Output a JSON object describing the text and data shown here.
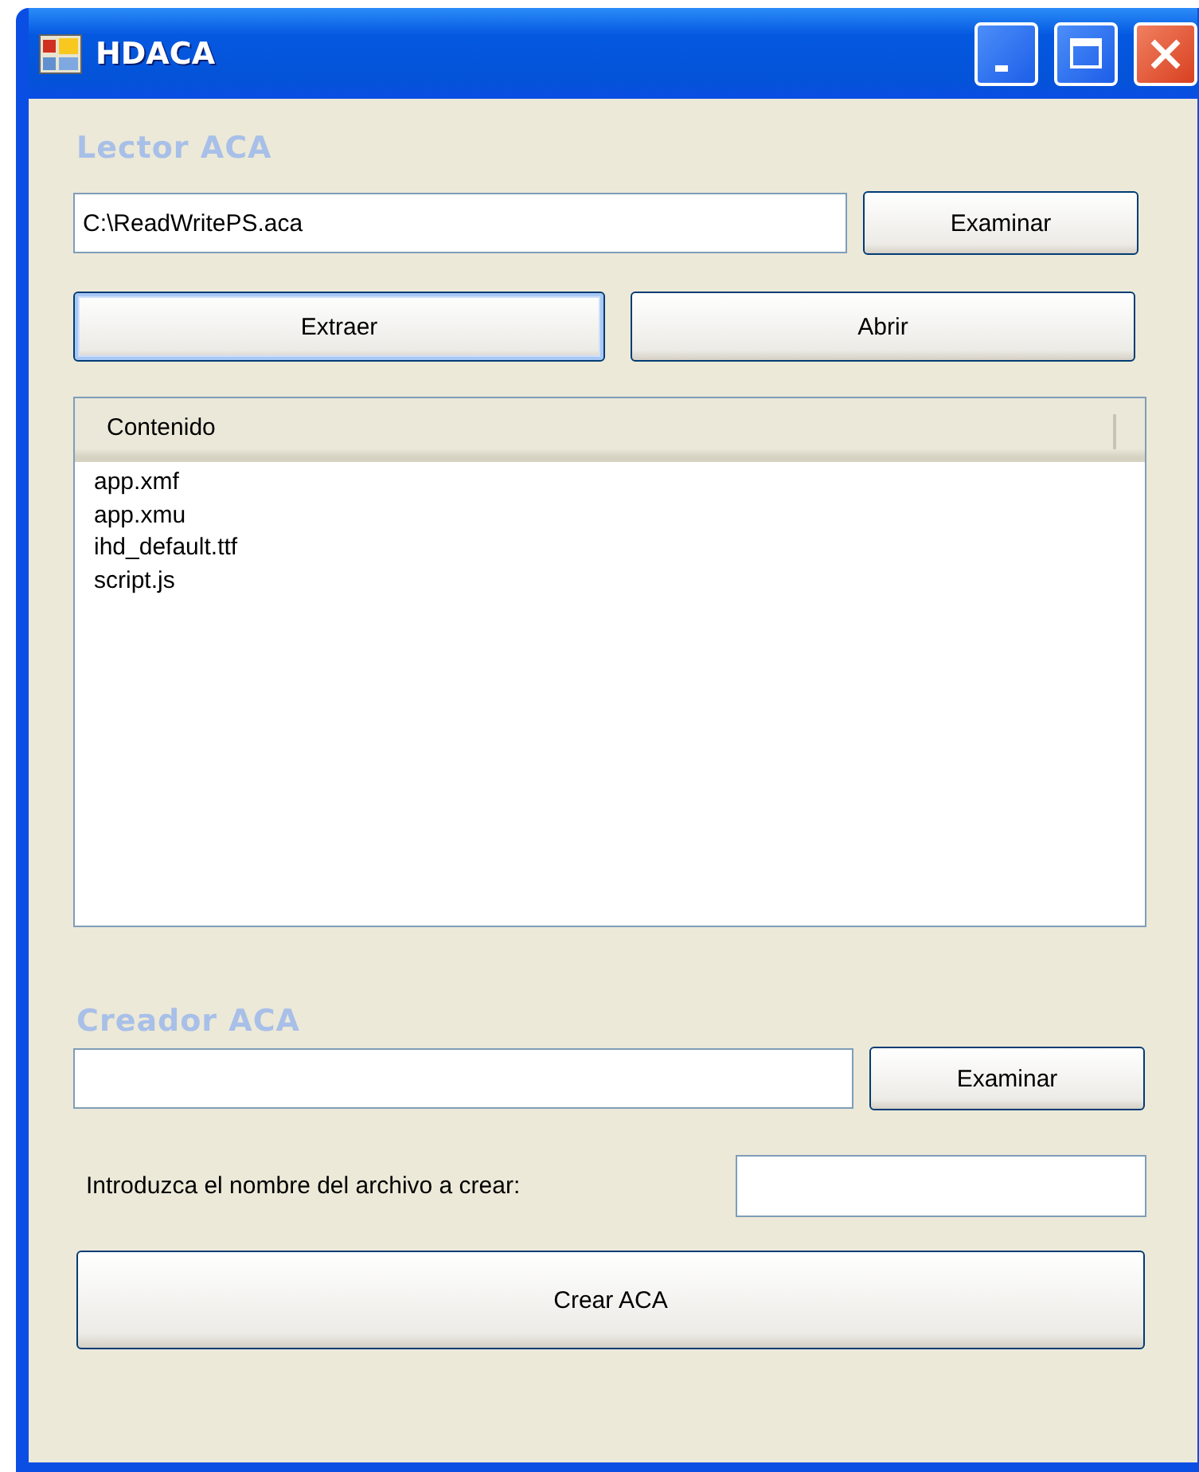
{
  "window": {
    "title": "HDACA"
  },
  "reader": {
    "heading": "Lector ACA",
    "path_field": {
      "value": "C:\\ReadWritePS.aca"
    },
    "browse_button": {
      "label": "Examinar",
      "focused": false
    },
    "buttons": [
      {
        "label": "Extraer",
        "focused": true
      },
      {
        "label": "Abrir",
        "focused": false
      }
    ],
    "list": {
      "column": "Contenido",
      "items": [
        "app.xmf",
        "app.xmu",
        "ihd_default.ttf",
        "script.js"
      ]
    }
  },
  "creator": {
    "heading": "Creador ACA",
    "browse_button": {
      "label": "Examinar",
      "focused": false
    },
    "name_label": "Introduzca el nombre del archivo a crear:",
    "create_button": {
      "label": "Crear ACA",
      "focused": false
    }
  }
}
